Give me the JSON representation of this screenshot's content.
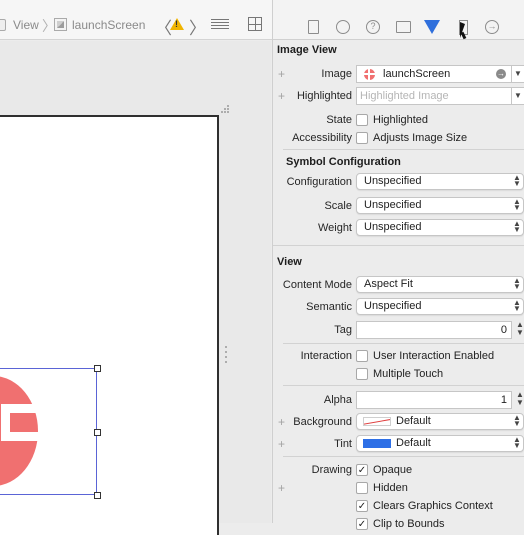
{
  "jumpbar": {
    "crumb_view": "View",
    "crumb_sep": "〉",
    "crumb_launch": "launchScreen",
    "nav_prev": "〈",
    "nav_next": "〉"
  },
  "inspector": {
    "image_view": {
      "title": "Image View",
      "image_label": "Image",
      "image_value": "launchScreen",
      "highlighted_label": "Highlighted",
      "highlighted_placeholder": "Highlighted Image",
      "state_label": "State",
      "state_option": "Highlighted",
      "accessibility_label": "Accessibility",
      "accessibility_option": "Adjusts Image Size"
    },
    "symbol_config": {
      "title": "Symbol Configuration",
      "configuration_label": "Configuration",
      "configuration_value": "Unspecified",
      "scale_label": "Scale",
      "scale_value": "Unspecified",
      "weight_label": "Weight",
      "weight_value": "Unspecified"
    },
    "view": {
      "title": "View",
      "content_mode_label": "Content Mode",
      "content_mode_value": "Aspect Fit",
      "semantic_label": "Semantic",
      "semantic_value": "Unspecified",
      "tag_label": "Tag",
      "tag_value": "0",
      "interaction_label": "Interaction",
      "user_interaction": "User Interaction Enabled",
      "multiple_touch": "Multiple Touch",
      "alpha_label": "Alpha",
      "alpha_value": "1",
      "background_label": "Background",
      "background_value": "Default",
      "tint_label": "Tint",
      "tint_value": "Default",
      "drawing_label": "Drawing",
      "opaque": "Opaque",
      "hidden": "Hidden",
      "clears_graphics": "Clears Graphics Context",
      "clip_to_bounds": "Clip to Bounds"
    },
    "checkbox_states": {
      "state_highlighted": false,
      "adjusts_image_size": false,
      "user_interaction_enabled": false,
      "multiple_touch": false,
      "opaque": true,
      "hidden": false,
      "clears_graphics_context": true,
      "clip_to_bounds": true
    }
  },
  "colors": {
    "accent": "#2f6fdc",
    "logo": "#f07070",
    "selection": "#5a64d6",
    "tint_swatch": "#2d6fe6"
  }
}
